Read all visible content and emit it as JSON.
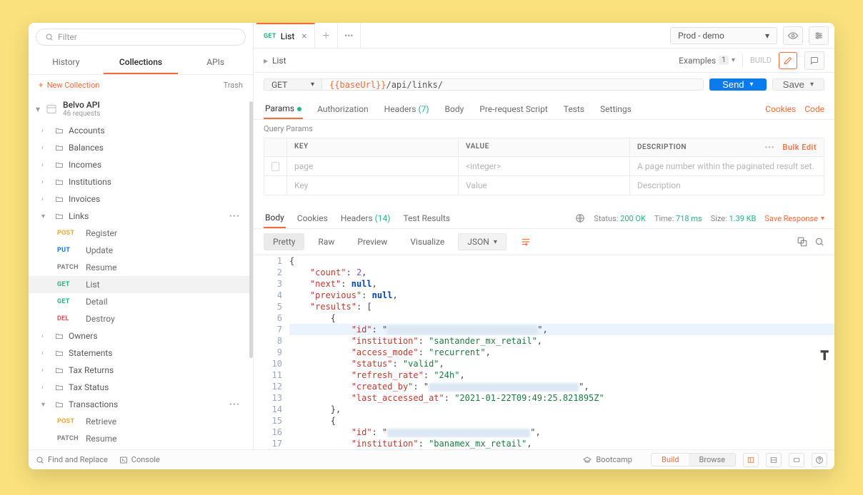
{
  "sidebar": {
    "filter_placeholder": "Filter",
    "tabs": {
      "history": "History",
      "collections": "Collections",
      "apis": "APIs"
    },
    "new_collection": "New Collection",
    "trash": "Trash",
    "collection": {
      "name": "Belvo API",
      "subtitle": "46 requests"
    },
    "folders": [
      {
        "name": "Accounts"
      },
      {
        "name": "Balances"
      },
      {
        "name": "Incomes"
      },
      {
        "name": "Institutions"
      },
      {
        "name": "Invoices"
      }
    ],
    "links_folder": "Links",
    "links_children": [
      {
        "method": "POST",
        "name": "Register"
      },
      {
        "method": "PUT",
        "name": "Update"
      },
      {
        "method": "PATCH",
        "name": "Resume"
      },
      {
        "method": "GET",
        "name": "List",
        "selected": true
      },
      {
        "method": "GET",
        "name": "Detail"
      },
      {
        "method": "DEL",
        "name": "Destroy"
      }
    ],
    "folders_after": [
      {
        "name": "Owners"
      },
      {
        "name": "Statements"
      },
      {
        "name": "Tax Returns"
      },
      {
        "name": "Tax Status"
      }
    ],
    "transactions_folder": "Transactions",
    "transactions_children": [
      {
        "method": "POST",
        "name": "Retrieve"
      },
      {
        "method": "PATCH",
        "name": "Resume"
      }
    ]
  },
  "topbar": {
    "tab_method": "GET",
    "tab_name": "List",
    "environment": "Prod - demo"
  },
  "crumb": {
    "name": "List",
    "examples_label": "Examples",
    "examples_count": "1",
    "build": "BUILD"
  },
  "url": {
    "method": "GET",
    "var": "{{baseUrl}}",
    "path": "/api/links/",
    "send": "Send",
    "save": "Save"
  },
  "reqtabs": {
    "params": "Params",
    "auth": "Authorization",
    "headers": "Headers",
    "headers_count": "(7)",
    "body": "Body",
    "prerequest": "Pre-request Script",
    "tests": "Tests",
    "settings": "Settings",
    "cookies": "Cookies",
    "code": "Code"
  },
  "query_params_label": "Query Params",
  "params_table": {
    "h_key": "KEY",
    "h_value": "VALUE",
    "h_desc": "DESCRIPTION",
    "bulk": "Bulk Edit",
    "row1_key": "page",
    "row1_val": "<integer>",
    "row1_desc": "A page number within the paginated result set.",
    "row2_key_ph": "Key",
    "row2_val_ph": "Value",
    "row2_desc_ph": "Description"
  },
  "resp": {
    "tabs": {
      "body": "Body",
      "cookies": "Cookies",
      "headers": "Headers",
      "headers_count": "(14)",
      "tests": "Test Results"
    },
    "status_pre": "Status:",
    "status_val": "200 OK",
    "time_pre": "Time:",
    "time_val": "718 ms",
    "size_pre": "Size:",
    "size_val": "1.39 KB",
    "save": "Save Response"
  },
  "view": {
    "pretty": "Pretty",
    "raw": "Raw",
    "preview": "Preview",
    "visualize": "Visualize",
    "json": "JSON"
  },
  "json_body": {
    "count": 2,
    "next": null,
    "previous": null,
    "results": [
      {
        "institution": "santander_mx_retail",
        "access_mode": "recurrent",
        "status": "valid",
        "refresh_rate": "24h",
        "last_accessed_at": "2021-01-22T09:49:25.821895Z"
      },
      {
        "institution": "banamex_mx_retail"
      }
    ]
  },
  "footer": {
    "find": "Find and Replace",
    "console": "Console",
    "bootcamp": "Bootcamp",
    "build": "Build",
    "browse": "Browse"
  }
}
